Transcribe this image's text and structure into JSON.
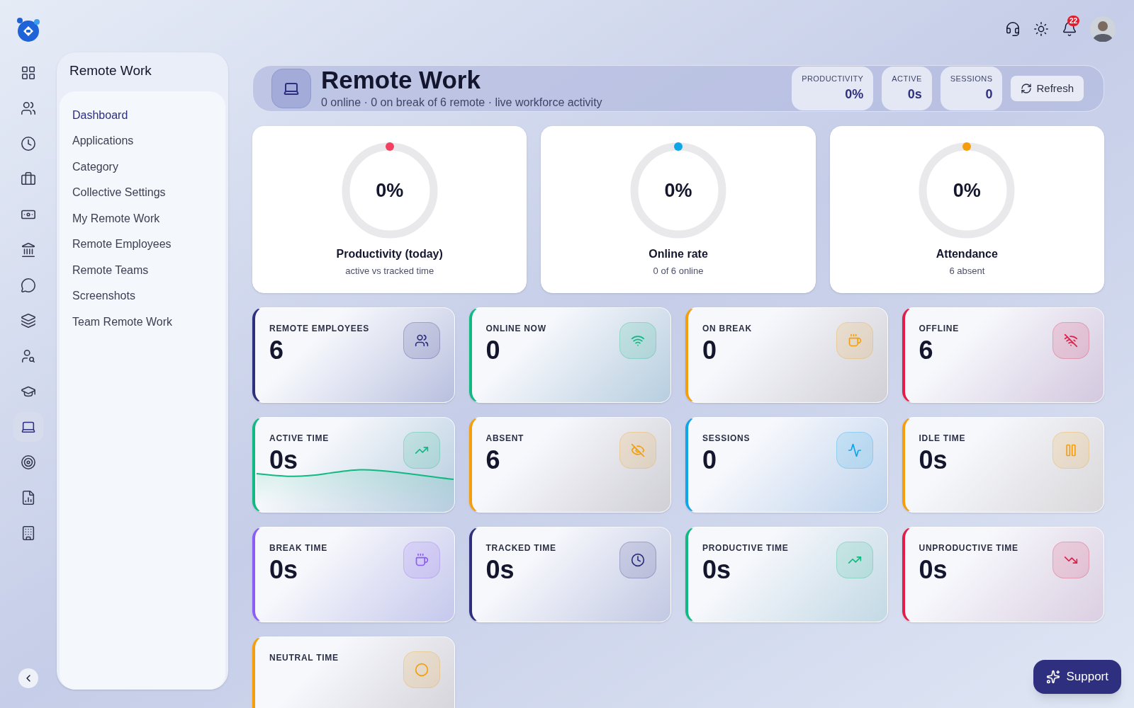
{
  "topbar": {
    "notification_count": "22"
  },
  "rail": [
    {
      "selected": false
    },
    {
      "selected": false
    },
    {
      "selected": false
    },
    {
      "selected": false
    },
    {
      "selected": false
    },
    {
      "selected": false
    },
    {
      "selected": false
    },
    {
      "selected": false
    },
    {
      "selected": false
    },
    {
      "selected": false
    },
    {
      "selected": true
    },
    {
      "selected": false
    },
    {
      "selected": false
    },
    {
      "selected": false
    }
  ],
  "submenu": {
    "title": "Remote Work",
    "items": [
      {
        "label": "Dashboard",
        "selected": true
      },
      {
        "label": "Applications",
        "selected": false
      },
      {
        "label": "Category",
        "selected": false
      },
      {
        "label": "Collective Settings",
        "selected": false
      },
      {
        "label": "My Remote Work",
        "selected": false
      },
      {
        "label": "Remote Employees",
        "selected": false
      },
      {
        "label": "Remote Teams",
        "selected": false
      },
      {
        "label": "Screenshots",
        "selected": false
      },
      {
        "label": "Team Remote Work",
        "selected": false
      }
    ]
  },
  "header": {
    "title": "Remote Work",
    "subtitle": "0 online · 0 on break of 6 remote · live workforce activity",
    "chips": [
      {
        "label": "PRODUCTIVITY",
        "value": "0%"
      },
      {
        "label": "ACTIVE",
        "value": "0s"
      },
      {
        "label": "SESSIONS",
        "value": "0"
      }
    ],
    "refresh": "Refresh"
  },
  "gauges": [
    {
      "value": "0%",
      "label": "Productivity (today)",
      "sub": "active vs tracked time",
      "level": 0,
      "color": "#f43f5e"
    },
    {
      "value": "0%",
      "label": "Online rate",
      "sub": "0 of 6 online",
      "level": 0,
      "color": "#0ea5e9"
    },
    {
      "value": "0%",
      "label": "Attendance",
      "sub": "6 absent",
      "level": 0,
      "color": "#f59e0b"
    }
  ],
  "stats": [
    {
      "label": "REMOTE EMPLOYEES",
      "value": "6",
      "color": "#2e2f7f",
      "kind": "plain"
    },
    {
      "label": "ONLINE NOW",
      "value": "0",
      "color": "#10b981",
      "kind": "plain"
    },
    {
      "label": "ON BREAK",
      "value": "0",
      "color": "#f59e0b",
      "kind": "plain"
    },
    {
      "label": "OFFLINE",
      "value": "6",
      "color": "#e11d48",
      "kind": "plain"
    },
    {
      "label": "ACTIVE TIME",
      "value": "0s",
      "color": "#10b981",
      "kind": "sparkline"
    },
    {
      "label": "ABSENT",
      "value": "6",
      "color": "#f59e0b",
      "kind": "plain"
    },
    {
      "label": "SESSIONS",
      "value": "0",
      "color": "#0ea5e9",
      "kind": "plain"
    },
    {
      "label": "IDLE TIME",
      "value": "0s",
      "color": "#f59e0b",
      "kind": "plain"
    },
    {
      "label": "BREAK TIME",
      "value": "0s",
      "color": "#8b5cf6",
      "kind": "plain"
    },
    {
      "label": "TRACKED TIME",
      "value": "0s",
      "color": "#2e2f7f",
      "kind": "plain"
    },
    {
      "label": "PRODUCTIVE TIME",
      "value": "0s",
      "color": "#10b981",
      "kind": "plain"
    },
    {
      "label": "UNPRODUCTIVE TIME",
      "value": "0s",
      "color": "#e11d48",
      "kind": "plain"
    },
    {
      "label": "NEUTRAL TIME",
      "color": "#f59e0b",
      "kind": "plain"
    }
  ],
  "support": "Support"
}
